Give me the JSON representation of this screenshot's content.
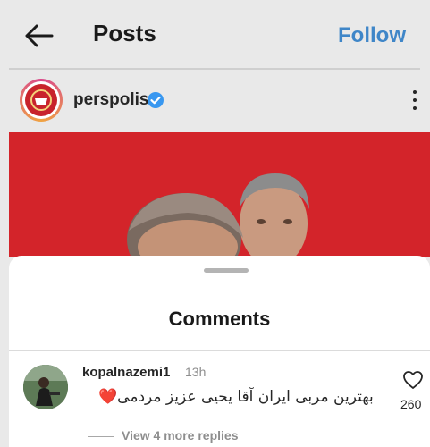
{
  "header": {
    "title": "Posts",
    "follow_label": "Follow"
  },
  "post": {
    "username": "perspolis",
    "verified": true
  },
  "comments_sheet": {
    "title": "Comments",
    "comments": [
      {
        "username": "kopalnazemi1",
        "time": "13h",
        "text": "بهترین مربی ایران آقا یحیی عزیز مردمی",
        "emoji": "❤️",
        "like_count": "260",
        "view_replies_label": "View 4 more replies"
      }
    ]
  },
  "colors": {
    "follow_blue": "#3f86c8",
    "post_red": "#d3242a",
    "verified_blue": "#3897f0"
  },
  "icons": [
    "back-arrow-icon",
    "verified-badge-icon",
    "more-options-icon",
    "heart-icon"
  ]
}
